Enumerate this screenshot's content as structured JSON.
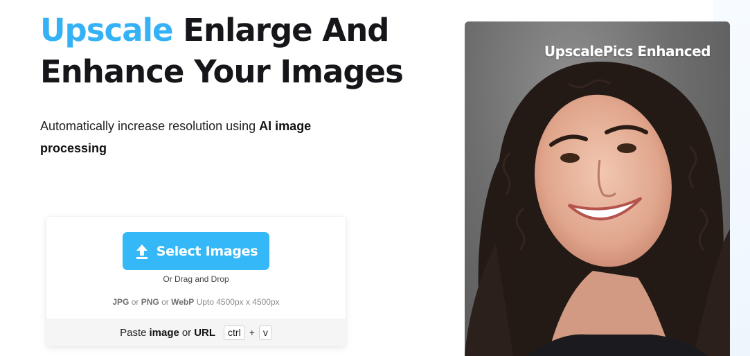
{
  "hero": {
    "title_accent": "Upscale",
    "title_rest": "Enlarge And",
    "title_line2": "Enhance Your Images"
  },
  "subtitle": {
    "text": "Automatically increase resolution using ",
    "bold": "AI image processing"
  },
  "upload": {
    "select_button_label": "Select Images",
    "upload_icon": "upload-arrow-icon",
    "drag_text": "Or Drag and Drop",
    "formats": {
      "jpg": "JPG",
      "or1": "or",
      "png": "PNG",
      "or2": "or",
      "webp": "WebP",
      "limit": "Upto 4500px x 4500px"
    },
    "paste": {
      "prefix": "Paste",
      "image": "image",
      "or": "or",
      "url": "URL",
      "key1": "ctrl",
      "plus": "+",
      "key2": "v"
    }
  },
  "preview": {
    "caption": "UpscalePics Enhanced"
  },
  "colors": {
    "accent": "#35b2f5",
    "button": "#35b8f7",
    "title": "#16161a"
  }
}
